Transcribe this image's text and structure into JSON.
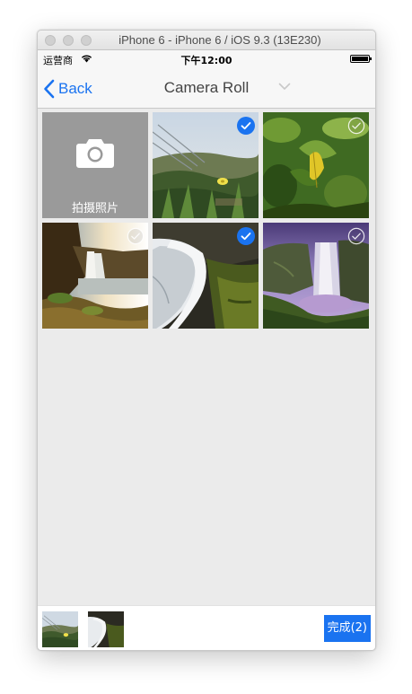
{
  "window": {
    "title": "iPhone 6 - iPhone 6 / iOS 9.3 (13E230)"
  },
  "statusbar": {
    "carrier": "运营商",
    "time": "下午12:00"
  },
  "navbar": {
    "back_label": "Back",
    "title": "Camera Roll",
    "icons": [
      "chevron-left-icon",
      "chevron-down-icon"
    ]
  },
  "grid": {
    "camera_label": "拍摄照片",
    "photos": [
      {
        "subject": "grass-flower-photo",
        "selected": true
      },
      {
        "subject": "green-leaves-photo",
        "selected": false
      },
      {
        "subject": "sunset-waterfall-photo",
        "selected": false
      },
      {
        "subject": "long-exposure-waterfall-photo",
        "selected": true
      },
      {
        "subject": "purple-waterfall-photo",
        "selected": false
      }
    ]
  },
  "bottombar": {
    "selected_thumbs": [
      "grass-flower-photo",
      "long-exposure-waterfall-photo"
    ],
    "done_label": "完成(2)"
  },
  "colors": {
    "accent": "#1a73f0",
    "background": "#ebebeb",
    "camera_cell": "#9a9a9a"
  }
}
